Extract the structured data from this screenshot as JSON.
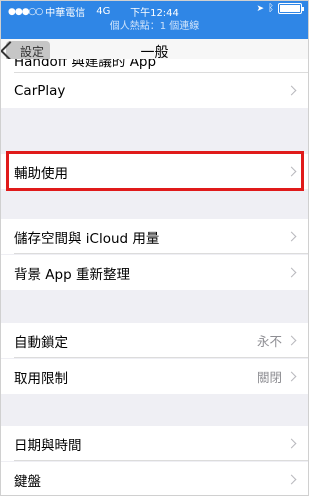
{
  "status_bar": {
    "carrier": "中華電信",
    "network": "4G",
    "time": "下午12:44",
    "hotspot": "個人熱點：1 個連線"
  },
  "nav": {
    "back_label": "設定",
    "title": "一般"
  },
  "rows": {
    "partial": "Handoff 與建議的 App",
    "carplay": "CarPlay",
    "accessibility": "輔助使用",
    "storage": "儲存空間與 iCloud 用量",
    "bg_refresh": "背景 App 重新整理",
    "auto_lock": {
      "label": "自動鎖定",
      "value": "永不"
    },
    "restrictions": {
      "label": "取用限制",
      "value": "關閉"
    },
    "date_time": "日期與時間",
    "keyboard": "鍵盤"
  },
  "highlight_color": "#e01a1a",
  "accent_color": "#2f86e6"
}
